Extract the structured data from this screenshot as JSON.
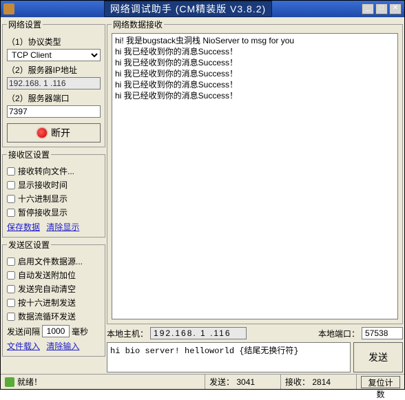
{
  "window": {
    "title": "网络调试助手 (CM精装版 V3.8.2)"
  },
  "left": {
    "net_settings_title": "网络设置",
    "proto_label": "（1）协议类型",
    "proto_value": "TCP Client",
    "ip_label": "（2）服务器IP地址",
    "ip_value": "192.168. 1 .116",
    "port_label": "（2）服务器端口",
    "port_value": "7397",
    "disconnect_label": "断开",
    "recv_settings_title": "接收区设置",
    "recv_checks": [
      "接收转向文件...",
      "显示接收时间",
      "十六进制显示",
      "暂停接收显示"
    ],
    "recv_link_save": "保存数据",
    "recv_link_clear": "清除显示",
    "send_settings_title": "发送区设置",
    "send_checks": [
      "启用文件数据源...",
      "自动发送附加位",
      "发送完自动清空",
      "按十六进制发送",
      "数据流循环发送"
    ],
    "interval_label": "发送间隔",
    "interval_value": "1000",
    "interval_unit": "毫秒",
    "send_link_file": "文件载入",
    "send_link_clear": "清除输入"
  },
  "right": {
    "recv_title": "网络数据接收",
    "recv_text": "hi! 我是bugstack虫洞栈 NioServer to msg for you\nhi 我已经收到你的消息Success！\nhi 我已经收到你的消息Success！\nhi 我已经收到你的消息Success！\nhi 我已经收到你的消息Success！\nhi 我已经收到你的消息Success！",
    "local_host_label": "本地主机：",
    "local_host_value": "192.168. 1 .116",
    "local_port_label": "本地端口：",
    "local_port_value": "57538",
    "send_text": "hi bio server! helloworld {结尾无换行符}",
    "send_btn": "发送"
  },
  "status": {
    "ready": "就绪！",
    "sent_label": "发送：",
    "sent_value": "3041",
    "recv_label": "接收：",
    "recv_value": "2814",
    "reset_label": "复位计数"
  }
}
